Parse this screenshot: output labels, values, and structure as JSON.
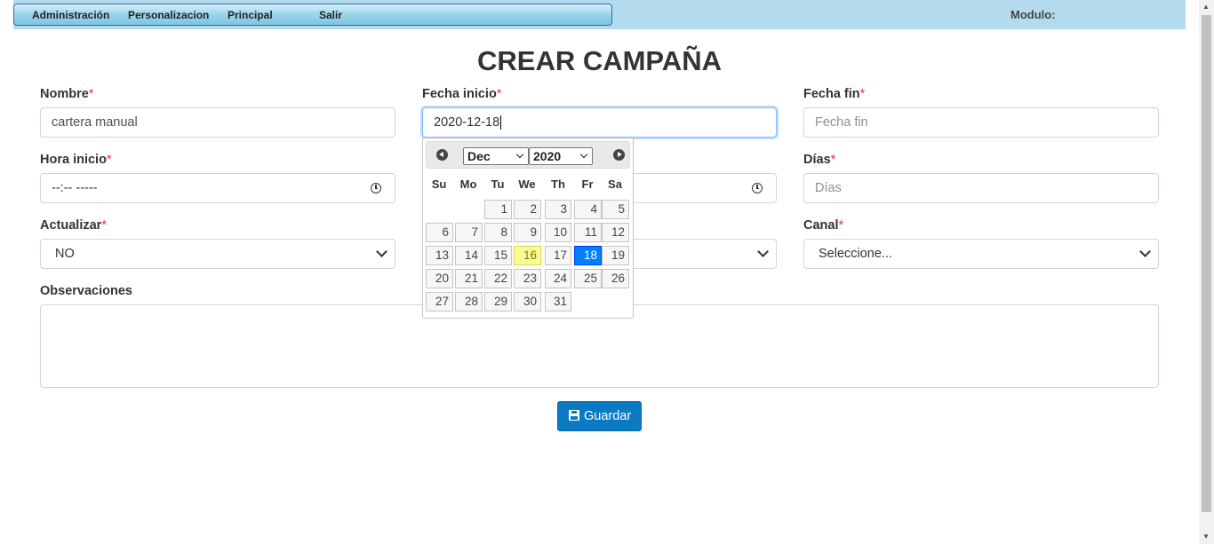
{
  "menu": {
    "items": [
      "Administración",
      "Personalizacion",
      "Principal",
      "Salir"
    ],
    "modulo_label": "Modulo:"
  },
  "page": {
    "title": "CREAR CAMPAÑA"
  },
  "form": {
    "nombre": {
      "label": "Nombre",
      "required_mark": "*",
      "value": "cartera manual"
    },
    "fecha_inicio": {
      "label": "Fecha inicio",
      "required_mark": "*",
      "value": "2020-12-18"
    },
    "fecha_fin": {
      "label": "Fecha fin",
      "required_mark": "*",
      "placeholder": "Fecha fin"
    },
    "hora_inicio": {
      "label": "Hora inicio",
      "required_mark": "*",
      "value": "--:-- -----"
    },
    "dias": {
      "label": "Días",
      "required_mark": "*",
      "placeholder": "Días"
    },
    "actualizar": {
      "label": "Actualizar",
      "required_mark": "*",
      "value": "NO"
    },
    "canal": {
      "label": "Canal",
      "required_mark": "*",
      "value": "Seleccione..."
    },
    "observaciones": {
      "label": "Observaciones"
    },
    "save_button": "Guardar"
  },
  "datepicker": {
    "month": "Dec",
    "year": "2020",
    "weekdays": [
      "Su",
      "Mo",
      "Tu",
      "We",
      "Th",
      "Fr",
      "Sa"
    ],
    "first_weekday_index": 2,
    "days_in_month": 31,
    "today": 16,
    "selected": 18
  },
  "colors": {
    "topbar": "#b4dbed",
    "primary_button": "#0a7bc2",
    "required": "#dc3545",
    "today_highlight": "#fffa90",
    "selected_day": "#007fff"
  }
}
